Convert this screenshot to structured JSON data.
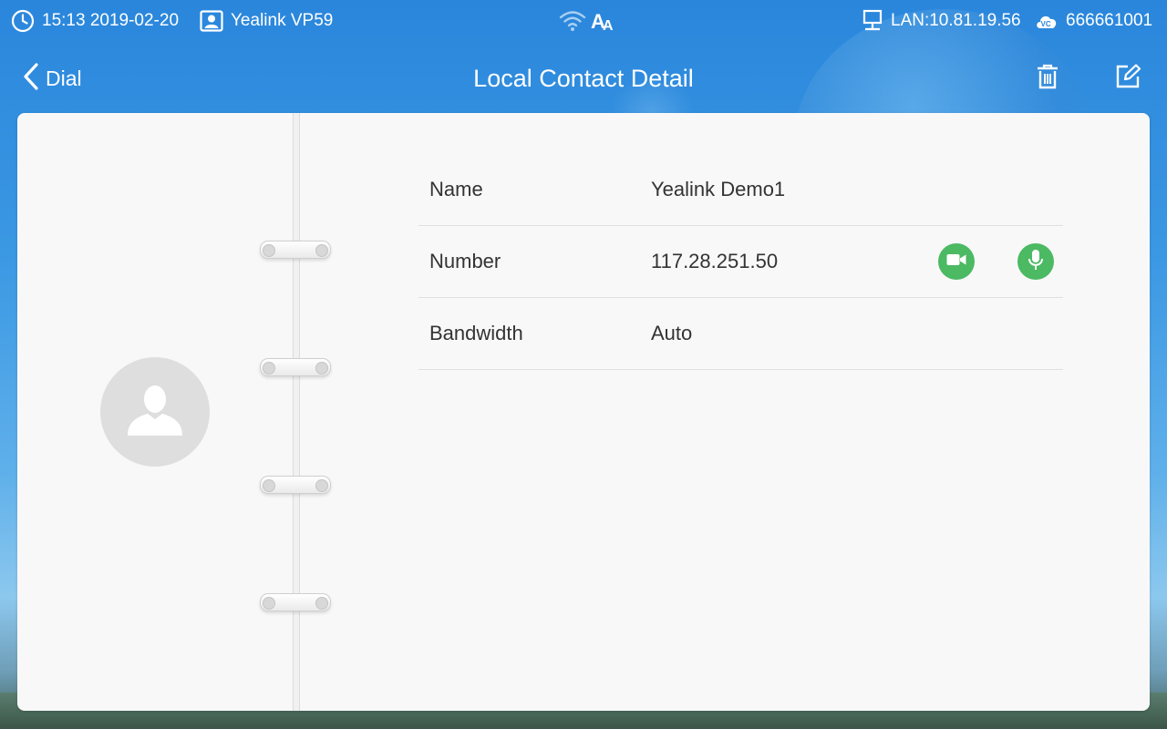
{
  "status_bar": {
    "time_date": "15:13 2019-02-20",
    "device_name": "Yealink VP59",
    "network": "LAN:10.81.19.56",
    "account": "666661001",
    "icons": [
      "clock-icon",
      "contact-card-icon",
      "wifi-icon",
      "font-size-icon",
      "lan-icon",
      "vc-cloud-icon"
    ]
  },
  "nav_bar": {
    "back_label": "Dial",
    "title": "Local Contact Detail",
    "icons": [
      "chevron-left-icon",
      "trash-icon",
      "edit-icon"
    ]
  },
  "contact": {
    "fields": [
      {
        "label": "Name",
        "value": "Yealink Demo1"
      },
      {
        "label": "Number",
        "value": "117.28.251.50"
      },
      {
        "label": "Bandwidth",
        "value": "Auto"
      }
    ],
    "actions": [
      "video-call-icon",
      "audio-call-icon"
    ]
  },
  "colors": {
    "accent_green": "#4cb963",
    "header_blue": "#2a86db",
    "card_bg": "#f8f8f8",
    "text": "#333333"
  }
}
